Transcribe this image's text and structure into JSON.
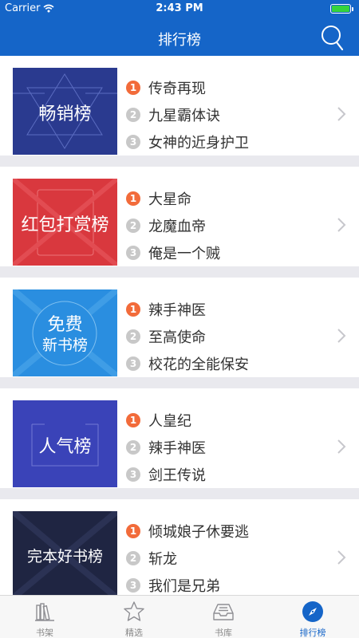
{
  "status_bar": {
    "carrier": "Carrier",
    "time": "2:43 PM"
  },
  "nav": {
    "title": "排行榜"
  },
  "rankings": [
    {
      "banner_lines": [
        "畅销榜"
      ],
      "books": [
        {
          "rank": "1",
          "title": "传奇再现"
        },
        {
          "rank": "2",
          "title": "九星霸体诀"
        },
        {
          "rank": "3",
          "title": "女神的近身护卫"
        }
      ]
    },
    {
      "banner_lines": [
        "红包打赏榜"
      ],
      "books": [
        {
          "rank": "1",
          "title": "大星命"
        },
        {
          "rank": "2",
          "title": "龙魔血帝"
        },
        {
          "rank": "3",
          "title": "俺是一个贼"
        }
      ]
    },
    {
      "banner_lines": [
        "免费",
        "新书榜"
      ],
      "books": [
        {
          "rank": "1",
          "title": "辣手神医"
        },
        {
          "rank": "2",
          "title": "至高使命"
        },
        {
          "rank": "3",
          "title": "校花的全能保安"
        }
      ]
    },
    {
      "banner_lines": [
        "人气榜"
      ],
      "books": [
        {
          "rank": "1",
          "title": "人皇纪"
        },
        {
          "rank": "2",
          "title": "辣手神医"
        },
        {
          "rank": "3",
          "title": "剑王传说"
        }
      ]
    },
    {
      "banner_lines": [
        "完本好书榜"
      ],
      "books": [
        {
          "rank": "1",
          "title": "倾城娘子休要逃"
        },
        {
          "rank": "2",
          "title": "斩龙"
        },
        {
          "rank": "3",
          "title": "我们是兄弟"
        }
      ]
    }
  ],
  "tabs": [
    {
      "label": "书架",
      "icon": "bookshelf-icon",
      "active": false
    },
    {
      "label": "精选",
      "icon": "star-icon",
      "active": false
    },
    {
      "label": "书库",
      "icon": "inbox-tray-icon",
      "active": false
    },
    {
      "label": "排行榜",
      "icon": "compass-icon",
      "active": true
    }
  ],
  "colors": {
    "header": "#1565c8",
    "badge_first": "#f26b3a",
    "badge_other": "#c8c8c8",
    "banner_1": "#2a3a8f",
    "banner_2": "#d9383e",
    "banner_3": "#2a8ee0",
    "banner_4": "#3a43b8",
    "banner_5": "#1f2542"
  }
}
